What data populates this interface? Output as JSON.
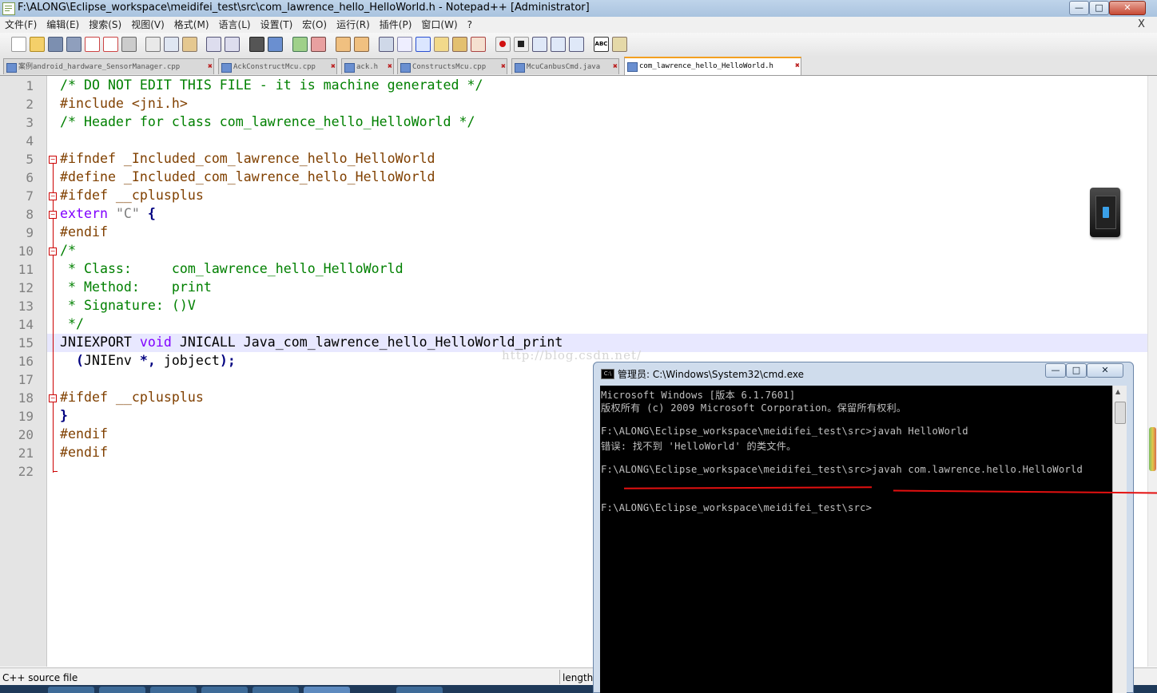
{
  "app": {
    "title": "F:\\ALONG\\Eclipse_workspace\\meidifei_test\\src\\com_lawrence_hello_HelloWorld.h - Notepad++ [Administrator]",
    "close_x": "X",
    "win_min": "—",
    "win_max": "□",
    "win_close": "✕"
  },
  "menu": [
    "文件(F)",
    "编辑(E)",
    "搜索(S)",
    "视图(V)",
    "格式(M)",
    "语言(L)",
    "设置(T)",
    "宏(O)",
    "运行(R)",
    "插件(P)",
    "窗口(W)",
    "?"
  ],
  "tabs": [
    {
      "label": "案例android_hardware_SensorManager.cpp",
      "active": false
    },
    {
      "label": "AckConstructMcu.cpp",
      "active": false
    },
    {
      "label": "ack.h",
      "active": false
    },
    {
      "label": "ConstructsMcu.cpp",
      "active": false
    },
    {
      "label": "McuCanbusCmd.java",
      "active": false
    },
    {
      "label": "com_lawrence_hello_HelloWorld.h",
      "active": true
    }
  ],
  "editor": {
    "line_numbers": [
      "1",
      "2",
      "3",
      "4",
      "5",
      "6",
      "7",
      "8",
      "9",
      "10",
      "11",
      "12",
      "13",
      "14",
      "15",
      "16",
      "17",
      "18",
      "19",
      "20",
      "21",
      "22"
    ],
    "lines": {
      "l1": "/* DO NOT EDIT THIS FILE - it is machine generated */",
      "l2": "#include <jni.h>",
      "l3": "/* Header for class com_lawrence_hello_HelloWorld */",
      "l5": "#ifndef _Included_com_lawrence_hello_HelloWorld",
      "l6": "#define _Included_com_lawrence_hello_HelloWorld",
      "l7": "#ifdef __cplusplus",
      "l8_kw": "extern",
      "l8_str": " \"C\" ",
      "l8_brace": "{",
      "l9": "#endif",
      "l10": "/*",
      "l11": " * Class:     com_lawrence_hello_HelloWorld",
      "l12": " * Method:    print",
      "l13": " * Signature: ()V",
      "l14": " */",
      "l15_a": "JNIEXPORT ",
      "l15_kw": "void",
      "l15_b": " JNICALL Java_com_lawrence_hello_HelloWorld_print",
      "l16_a": "  ",
      "l16_op1": "(",
      "l16_b": "JNIEnv ",
      "l16_op2": "*,",
      "l16_c": " jobject",
      "l16_op3": ");",
      "l18": "#ifdef __cplusplus",
      "l19": "}",
      "l20": "#endif",
      "l21": "#endif"
    },
    "watermark": "http://blog.csdn.net/"
  },
  "cmd": {
    "title": "管理员: C:\\Windows\\System32\\cmd.exe",
    "lines": [
      "Microsoft Windows [版本 6.1.7601]",
      "版权所有 (c) 2009 Microsoft Corporation。保留所有权利。",
      "",
      "F:\\ALONG\\Eclipse_workspace\\meidifei_test\\src>javah HelloWorld",
      "错误: 找不到 'HelloWorld' 的类文件。",
      "",
      "F:\\ALONG\\Eclipse_workspace\\meidifei_test\\src>javah com.lawrence.hello.HelloWorld",
      "",
      "",
      "F:\\ALONG\\Eclipse_workspace\\meidifei_test\\src>"
    ]
  },
  "status": {
    "file_type": "C++ source file",
    "length_label": "length"
  },
  "colors": {
    "comment": "#008000",
    "preprocessor": "#804000",
    "keyword": "#8000ff",
    "annotation": "#e41010"
  }
}
